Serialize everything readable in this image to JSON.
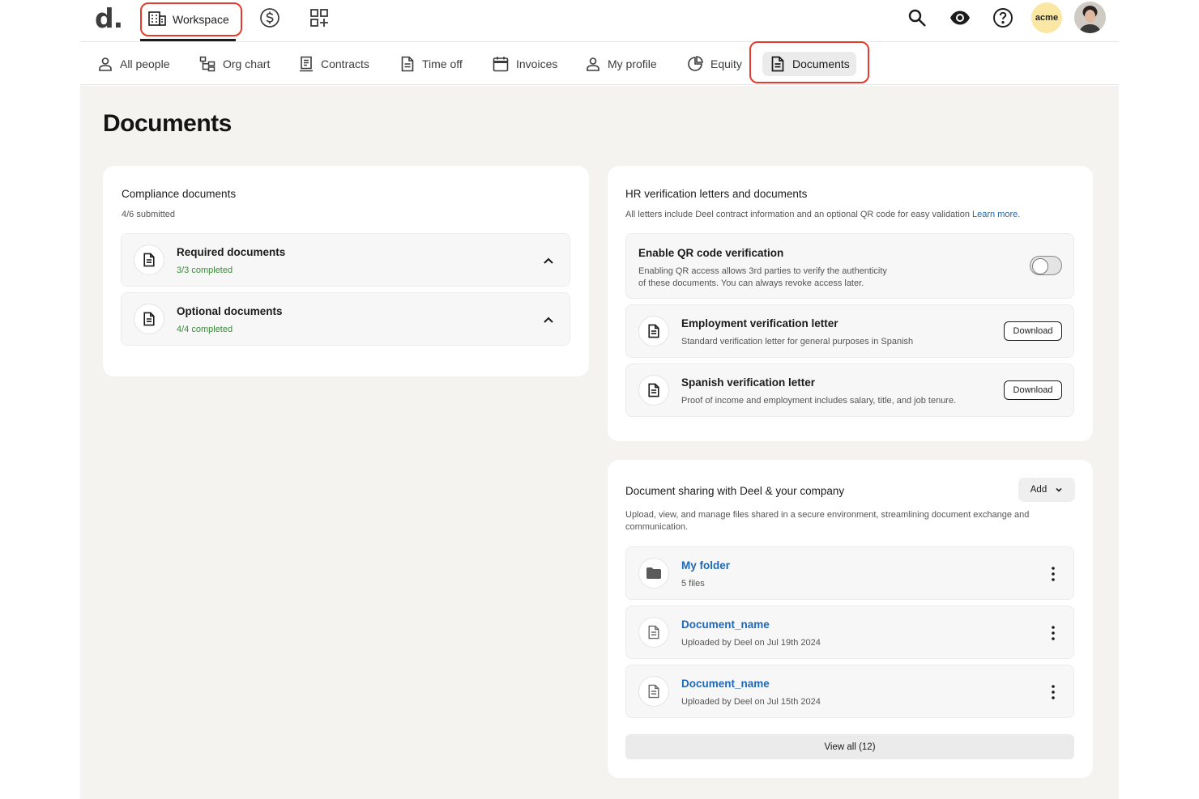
{
  "topbar": {
    "logo": "d.",
    "workspace_label": "Workspace",
    "acme_label": "acme"
  },
  "tabs": [
    {
      "label": "All people",
      "icon": "person-icon"
    },
    {
      "label": "Org chart",
      "icon": "org-chart-icon"
    },
    {
      "label": "Contracts",
      "icon": "contract-icon"
    },
    {
      "label": "Time off",
      "icon": "document-icon"
    },
    {
      "label": "Invoices",
      "icon": "calendar-icon"
    },
    {
      "label": "My profile",
      "icon": "person-icon"
    },
    {
      "label": "Equity",
      "icon": "pie-chart-icon"
    },
    {
      "label": "Documents",
      "icon": "document-icon",
      "active": true
    }
  ],
  "page": {
    "title": "Documents"
  },
  "compliance": {
    "title": "Compliance documents",
    "subtitle": "4/6 submitted",
    "items": [
      {
        "title": "Required documents",
        "status": "3/3 completed"
      },
      {
        "title": "Optional documents",
        "status": "4/4 completed"
      }
    ]
  },
  "hr": {
    "title": "HR verification letters and documents",
    "subtitle": "All letters include Deel contract information and an optional QR code for easy validation",
    "learn_more": "Learn more.",
    "qr": {
      "title": "Enable QR code verification",
      "desc_line1": "Enabling QR access allows 3rd parties to verify the authenticity",
      "desc_line2": "of these documents. You can always revoke access later.",
      "enabled": false
    },
    "letters": [
      {
        "title": "Employment verification letter",
        "desc": "Standard verification letter for general purposes in Spanish",
        "button": "Download"
      },
      {
        "title": "Spanish verification letter",
        "desc": "Proof of income and employment includes salary, title, and job tenure.",
        "button": "Download"
      }
    ]
  },
  "sharing": {
    "title": "Document sharing with Deel & your company",
    "add_label": "Add",
    "desc_line1": "Upload, view, and manage files shared in a secure environment, streamlining document exchange and",
    "desc_line2": "communication.",
    "files": [
      {
        "name": "My folder",
        "meta": "5 files",
        "icon": "folder-icon"
      },
      {
        "name": "Document_name",
        "meta": "Uploaded by Deel on Jul 19th 2024",
        "icon": "document-icon"
      },
      {
        "name": "Document_name",
        "meta": "Uploaded by Deel on Jul 15th 2024",
        "icon": "document-icon"
      }
    ],
    "view_all": "View all (12)"
  },
  "colors": {
    "highlight": "#e53b2c",
    "link": "#1f68b3",
    "success": "#3a8a3a",
    "background": "#f4f3f0"
  }
}
